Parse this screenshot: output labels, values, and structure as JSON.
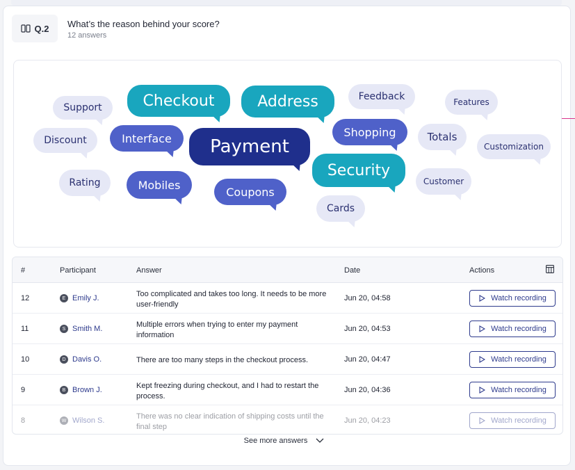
{
  "question": {
    "badge": "Q.2",
    "title": "What’s the reason behind your score?",
    "answers_count": "12 answers"
  },
  "word_cloud": [
    {
      "word": "Support",
      "style": "light"
    },
    {
      "word": "Checkout",
      "style": "teal"
    },
    {
      "word": "Address",
      "style": "teal"
    },
    {
      "word": "Feedback",
      "style": "light"
    },
    {
      "word": "Features",
      "style": "light"
    },
    {
      "word": "Discount",
      "style": "light"
    },
    {
      "word": "Interface",
      "style": "blue"
    },
    {
      "word": "Payment",
      "style": "navy"
    },
    {
      "word": "Shopping",
      "style": "blue"
    },
    {
      "word": "Totals",
      "style": "light"
    },
    {
      "word": "Customization",
      "style": "light"
    },
    {
      "word": "Security",
      "style": "teal"
    },
    {
      "word": "Rating",
      "style": "light"
    },
    {
      "word": "Mobiles",
      "style": "blue"
    },
    {
      "word": "Coupons",
      "style": "blue"
    },
    {
      "word": "Customer",
      "style": "light"
    },
    {
      "word": "Cards",
      "style": "light"
    }
  ],
  "table": {
    "headers": {
      "num": "#",
      "participant": "Participant",
      "answer": "Answer",
      "date": "Date",
      "actions": "Actions"
    },
    "rows": [
      {
        "num": "12",
        "initial": "E",
        "name": "Emily J.",
        "answer": "Too complicated and takes too long. It needs to be more user-friendly",
        "date": "Jun 20, 04:58",
        "action": "Watch recording"
      },
      {
        "num": "11",
        "initial": "S",
        "name": "Smith M.",
        "answer": "Multiple errors when trying to enter my payment information",
        "date": "Jun 20, 04:53",
        "action": "Watch recording"
      },
      {
        "num": "10",
        "initial": "D",
        "name": "Davis O.",
        "answer": "There are too many steps in the checkout process.",
        "date": "Jun 20, 04:47",
        "action": "Watch recording"
      },
      {
        "num": "9",
        "initial": "B",
        "name": "Brown J.",
        "answer": "Kept freezing during checkout, and I had to restart the process.",
        "date": "Jun 20, 04:36",
        "action": "Watch recording"
      },
      {
        "num": "8",
        "initial": "W",
        "name": "Wilson S.",
        "answer": "There was no clear indication of shipping costs until the final step",
        "date": "Jun 20, 04:23",
        "action": "Watch recording"
      }
    ]
  },
  "see_more": "See more answers",
  "colors": {
    "teal": "#19a6be",
    "blue": "#4f61c9",
    "navy": "#1f2f8c",
    "light": "#e6e8f6",
    "link": "#2d3a8c"
  },
  "icons": {
    "badge": "smiley-face-icon",
    "columns": "table-columns-icon",
    "play": "play-icon",
    "chevron": "chevron-down-icon"
  }
}
